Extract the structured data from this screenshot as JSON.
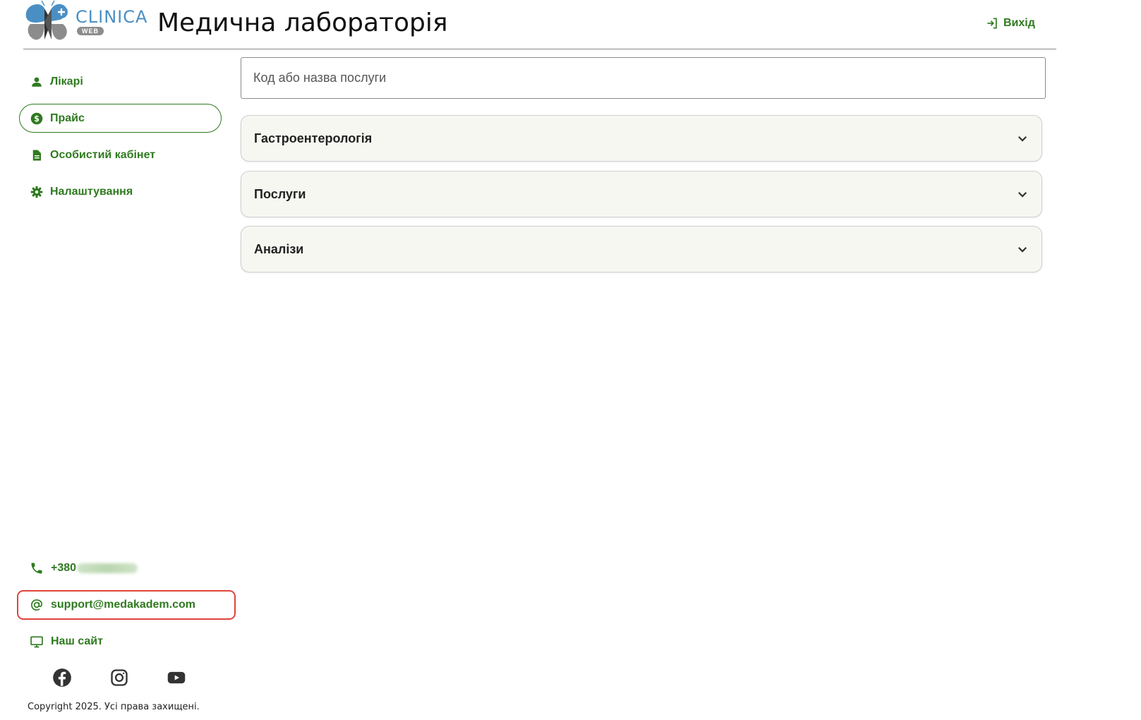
{
  "header": {
    "brand_name": "CLINICA",
    "brand_badge": "WEB",
    "title": "Медична лабораторія",
    "logout_label": "Вихід",
    "logout_icon": "sign-in-icon"
  },
  "sidebar": {
    "items": [
      {
        "label": "Лікарі",
        "icon": "user-icon",
        "active": false
      },
      {
        "label": "Прайс",
        "icon": "dollar-icon",
        "active": true
      },
      {
        "label": "Особистий кабінет",
        "icon": "document-icon",
        "active": false
      },
      {
        "label": "Налаштування",
        "icon": "gear-icon",
        "active": false
      }
    ]
  },
  "search": {
    "placeholder": "Код або назва послуги",
    "value": ""
  },
  "accordions": [
    {
      "label": "Гастроентерологія",
      "expanded": false
    },
    {
      "label": "Послуги",
      "expanded": false
    },
    {
      "label": "Аналізи",
      "expanded": false
    }
  ],
  "contacts": {
    "phone": "+380",
    "email": "support@medakadem.com",
    "site": "Наш сайт"
  },
  "social": [
    "facebook-icon",
    "instagram-icon",
    "youtube-icon"
  ],
  "footer": {
    "copyright": "Copyright 2025. Усі права захищені."
  },
  "colors": {
    "accent": "#2f7a1f",
    "highlight": "#e0443a",
    "accordion_bg": "#f7f7f2",
    "brand_blue": "#4a8fc4"
  }
}
